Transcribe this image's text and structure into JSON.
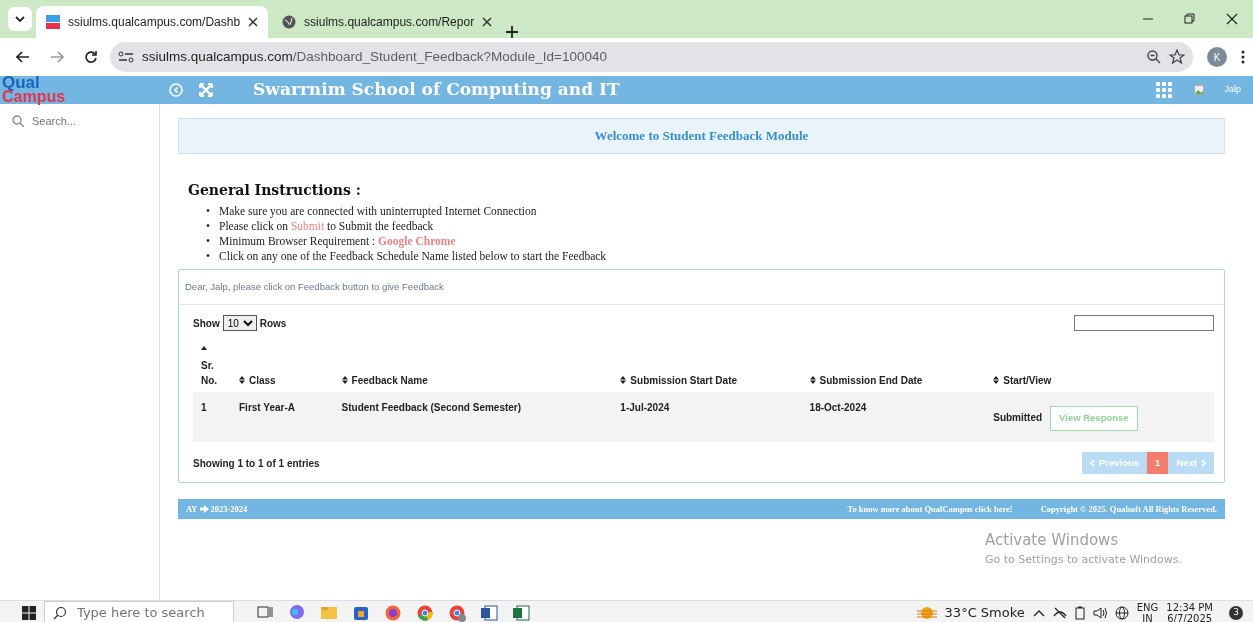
{
  "browser": {
    "tabs": [
      {
        "title": "ssiulms.qualcampus.com/Dashb",
        "selected": true,
        "kind": "site"
      },
      {
        "title": "ssiulms.qualcampus.com/Repor",
        "selected": false,
        "kind": "globe"
      }
    ],
    "address": {
      "host": "ssiulms.qualcampus.com",
      "path": "/Dashboard_Student_Feedback?Module_Id=100040"
    },
    "profile": "K"
  },
  "app_header": {
    "logo_top": "Qual",
    "logo_bottom": "Campus",
    "title": "Swarrnim School of Computing and IT",
    "user": "Jalp"
  },
  "sidebar": {
    "search": {
      "placeholder": "Search..."
    }
  },
  "welcome": "Welcome to Student Feedback Module",
  "instructions": {
    "title": "General Instructions :",
    "items": [
      {
        "marker": "•",
        "parts": [
          {
            "text": "Make sure you are connected with uninterrupted Internet Connection",
            "highlighted": false
          }
        ]
      },
      {
        "marker": "•",
        "parts": [
          {
            "text": "Please click on ",
            "highlighted": false
          },
          {
            "text": "Submit",
            "highlighted": true
          },
          {
            "text": " to Submit the feedback",
            "highlighted": false
          }
        ]
      },
      {
        "marker": "•",
        "parts": [
          {
            "text": "Minimum Browser Requirement : ",
            "highlighted": false
          },
          {
            "text": "**Google Chrome**",
            "highlighted": true
          }
        ]
      },
      {
        "marker": "•",
        "parts": [
          {
            "text": "Click on any one of the Feedback Schedule Name listed below to start the Feedback",
            "highlighted": false
          }
        ]
      }
    ]
  },
  "card": {
    "greeting": "Dear, Jalp, please click on Feedback button to give Feedback",
    "show_label": "Show",
    "page_size": "10",
    "rows_label": "Rows",
    "columns": [
      {
        "label": "Sr. No.",
        "sorted": true
      },
      {
        "label": "Class",
        "sorted": false
      },
      {
        "label": "Feedback Name",
        "sorted": false
      },
      {
        "label": "Submission Start Date",
        "sorted": false
      },
      {
        "label": "Submission End Date",
        "sorted": false
      },
      {
        "label": "Start/View",
        "sorted": false
      }
    ],
    "rows": [
      {
        "cells": [
          "1",
          "First Year-A",
          "Student Feedback (Second Semester)",
          "1-Jul-2024",
          "18-Oct-2024"
        ],
        "status": "Submitted",
        "action": "View Response"
      }
    ],
    "info": "Showing 1 to 1 of 1 entries",
    "pagination": {
      "previous": {
        "label": "Previous",
        "disabled": true
      },
      "pages": [
        {
          "label": "1",
          "selected": true
        }
      ],
      "next": {
        "label": "Next",
        "disabled": true
      }
    }
  },
  "footer": {
    "year_label": "AY",
    "year": "2023-2024",
    "link": "To know more about QualCampus click here!",
    "copyright": "Copyright © 2025. Qualsoft All Rights Reserved."
  },
  "activation": {
    "title": "Activate Windows",
    "subtitle": "Go to Settings to activate Windows."
  },
  "taskbar": {
    "search_placeholder": "Type here to search",
    "weather": "33°C Smoke",
    "lang": "ENG",
    "region": "IN",
    "time": "12:34 PM",
    "date": "6/7/2025",
    "notifications": "3"
  }
}
